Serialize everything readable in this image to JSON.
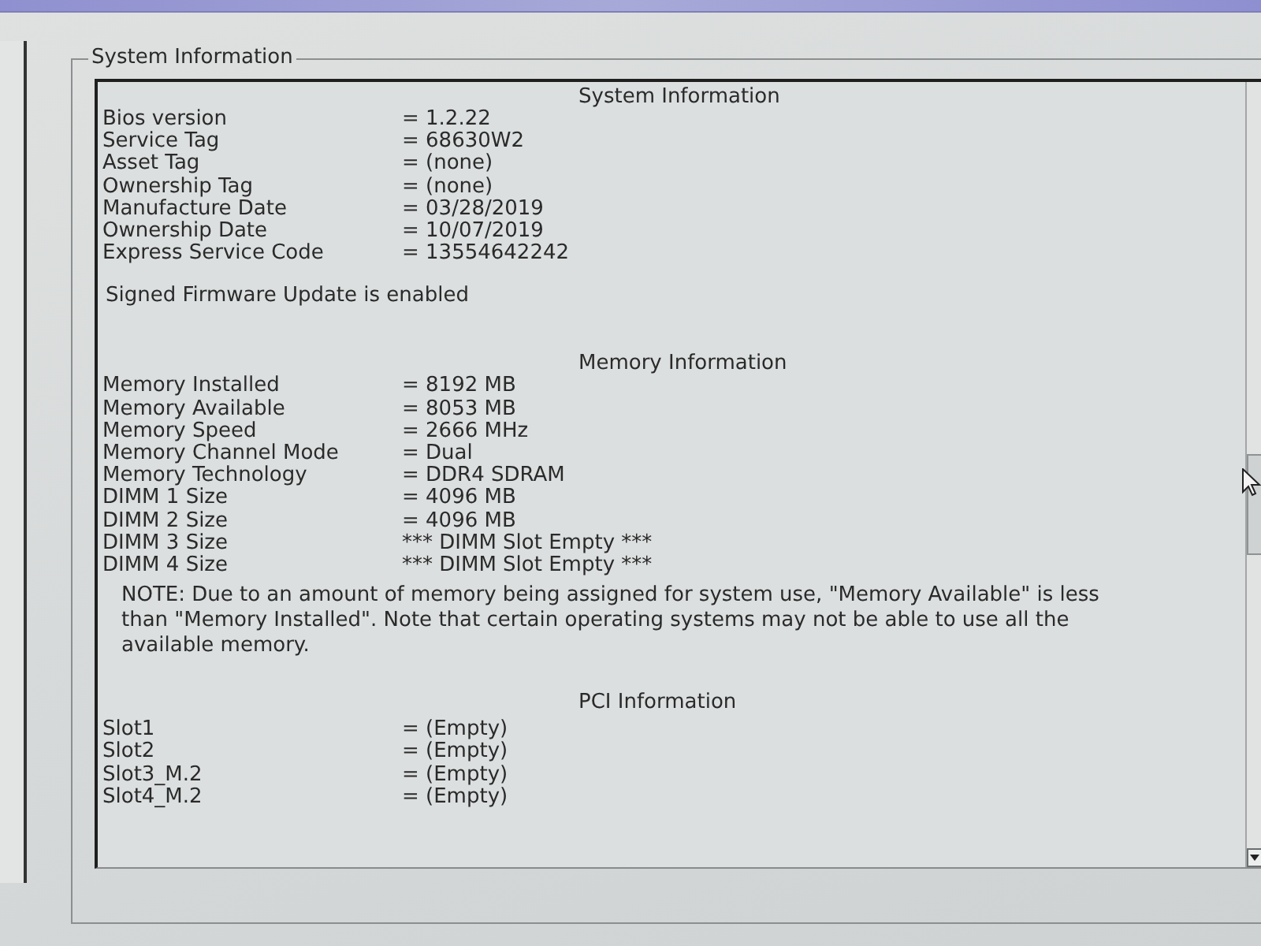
{
  "group_box": {
    "title": "System Information",
    "sections": [
      {
        "heading": "System Information",
        "rows": [
          {
            "label": "Bios version",
            "value": "= 1.2.22"
          },
          {
            "label": "Service Tag",
            "value": "= 68630W2"
          },
          {
            "label": "Asset Tag",
            "value": "= (none)"
          },
          {
            "label": "Ownership Tag",
            "value": "= (none)"
          },
          {
            "label": "Manufacture Date",
            "value": "= 03/28/2019"
          },
          {
            "label": "Ownership Date",
            "value": "= 10/07/2019"
          },
          {
            "label": "Express Service Code",
            "value": "= 13554642242"
          }
        ],
        "note": "Signed Firmware Update is enabled"
      },
      {
        "heading": "Memory Information",
        "rows": [
          {
            "label": "Memory Installed",
            "value": "= 8192 MB"
          },
          {
            "label": "Memory Available",
            "value": "= 8053 MB"
          },
          {
            "label": "Memory Speed",
            "value": "= 2666 MHz"
          },
          {
            "label": "Memory Channel Mode",
            "value": "= Dual"
          },
          {
            "label": "Memory Technology",
            "value": "= DDR4 SDRAM"
          },
          {
            "label": "DIMM 1 Size",
            "value": "= 4096 MB"
          },
          {
            "label": "DIMM 2 Size",
            "value": "= 4096 MB"
          },
          {
            "label": "DIMM 3 Size",
            "value": "*** DIMM Slot Empty ***"
          },
          {
            "label": "DIMM 4 Size",
            "value": "*** DIMM Slot Empty ***"
          }
        ],
        "note": "NOTE: Due to an amount of memory being assigned for system use, \"Memory Available\" is less than \"Memory Installed\". Note that certain operating systems may not be able to use all the available memory."
      },
      {
        "heading": "PCI Information",
        "rows": [
          {
            "label": "Slot1",
            "value": "= (Empty)"
          },
          {
            "label": "Slot2",
            "value": "= (Empty)"
          },
          {
            "label": "Slot3_M.2",
            "value": "= (Empty)"
          },
          {
            "label": "Slot4_M.2",
            "value": "= (Empty)"
          }
        ]
      }
    ]
  }
}
